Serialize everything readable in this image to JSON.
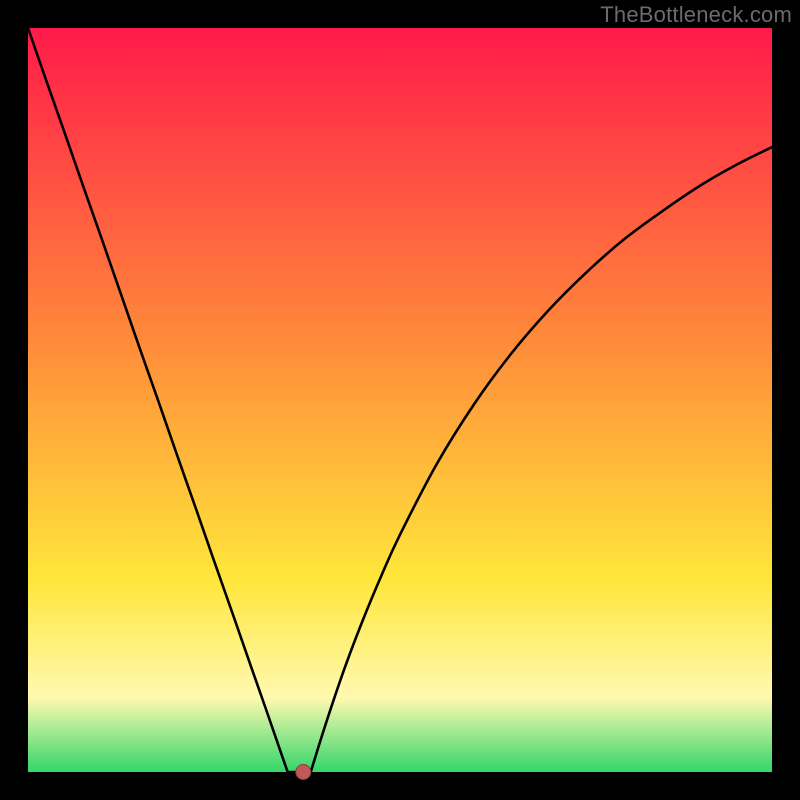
{
  "watermark": "TheBottleneck.com",
  "colors": {
    "frame": "#000000",
    "curve": "#000000",
    "marker_fill": "#c05a5a",
    "marker_stroke": "#8a3a3a",
    "grad_top": "#ff1a4a",
    "grad_orange": "#ff8a3a",
    "grad_yellow": "#ffe63a",
    "grad_pale": "#fff9b0",
    "grad_green": "#34d66a"
  },
  "chart_data": {
    "type": "line",
    "title": "",
    "xlabel": "",
    "ylabel": "",
    "x": [
      0.0,
      0.025,
      0.05,
      0.075,
      0.1,
      0.125,
      0.15,
      0.175,
      0.2,
      0.225,
      0.25,
      0.275,
      0.3,
      0.32,
      0.34,
      0.349,
      0.35,
      0.36,
      0.37,
      0.38,
      0.4,
      0.425,
      0.45,
      0.475,
      0.5,
      0.55,
      0.6,
      0.65,
      0.7,
      0.75,
      0.8,
      0.85,
      0.9,
      0.95,
      1.0
    ],
    "values": [
      1.0,
      0.928,
      0.857,
      0.785,
      0.714,
      0.642,
      0.57,
      0.499,
      0.427,
      0.356,
      0.284,
      0.213,
      0.141,
      0.084,
      0.026,
      0.0,
      0.0,
      0.0,
      0.0,
      0.0,
      0.064,
      0.138,
      0.204,
      0.264,
      0.319,
      0.415,
      0.495,
      0.563,
      0.621,
      0.671,
      0.715,
      0.752,
      0.786,
      0.815,
      0.84
    ],
    "xlim": [
      0,
      1
    ],
    "ylim": [
      0,
      1
    ],
    "marker": {
      "x": 0.37,
      "y": 0.0
    },
    "plateau_x": [
      0.349,
      0.38
    ]
  }
}
